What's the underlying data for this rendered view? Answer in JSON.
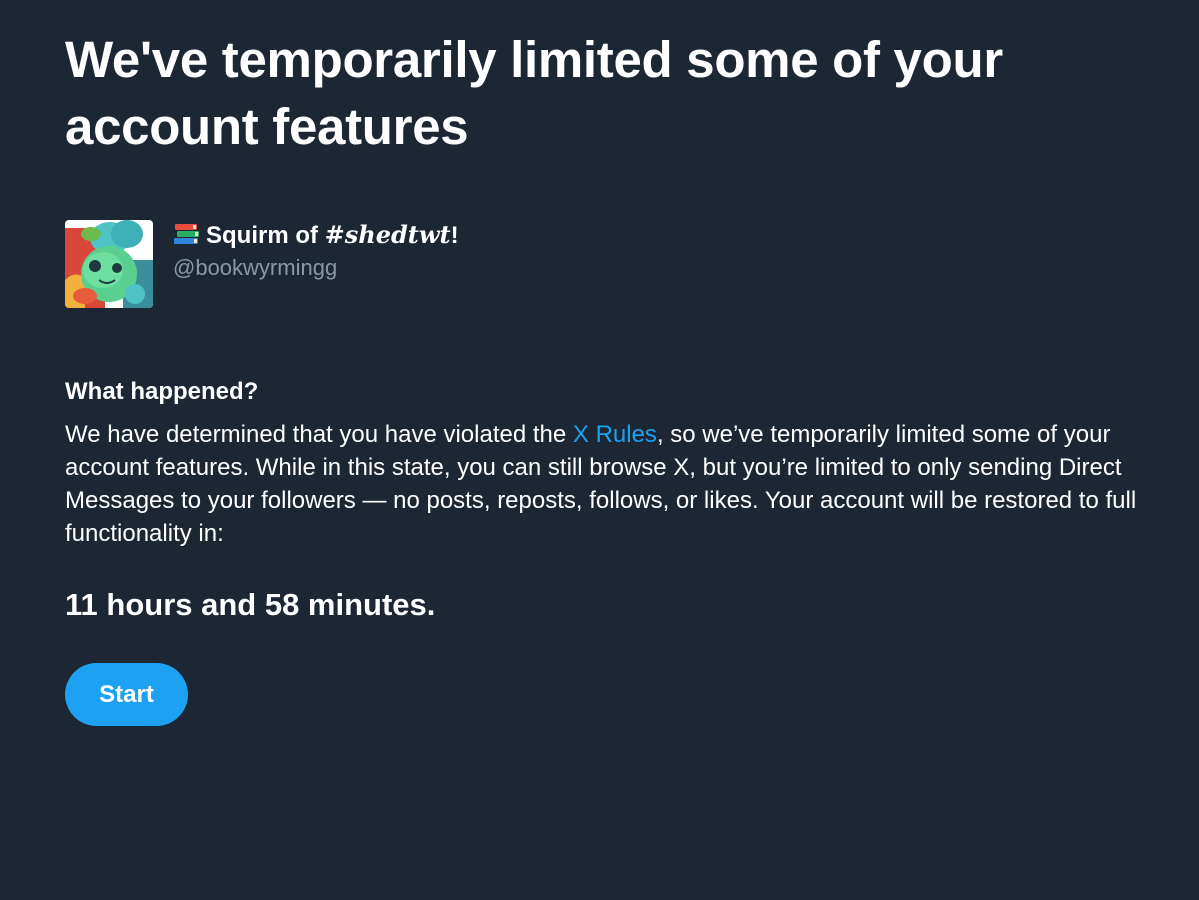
{
  "page": {
    "title": "We've temporarily limited some of your account features"
  },
  "profile": {
    "name_prefix_icon": "books-emoji-icon",
    "name_before_tag": "Squirm of ",
    "name_tag": "#shedtwt",
    "name_after_tag": "!",
    "handle": "@bookwyrmingg",
    "avatar_icon": "avatar-illustration"
  },
  "notice": {
    "heading": "What happened?",
    "text_before_link": "We have determined that you have violated the ",
    "link_text": "X Rules",
    "text_after_link": ", so we’ve temporarily limited some of your account features. While in this state, you can still browse X, but you’re limited to only sending Direct Messages to your followers — no posts, reposts, follows, or likes. Your account will be restored to full functionality in:",
    "link_color": "#1da1f2"
  },
  "countdown": {
    "text": "11 hours and 58 minutes."
  },
  "actions": {
    "start_label": "Start",
    "start_color": "#1da1f2"
  },
  "theme": {
    "background": "#1c2733",
    "secondary_text": "#8899a6"
  }
}
